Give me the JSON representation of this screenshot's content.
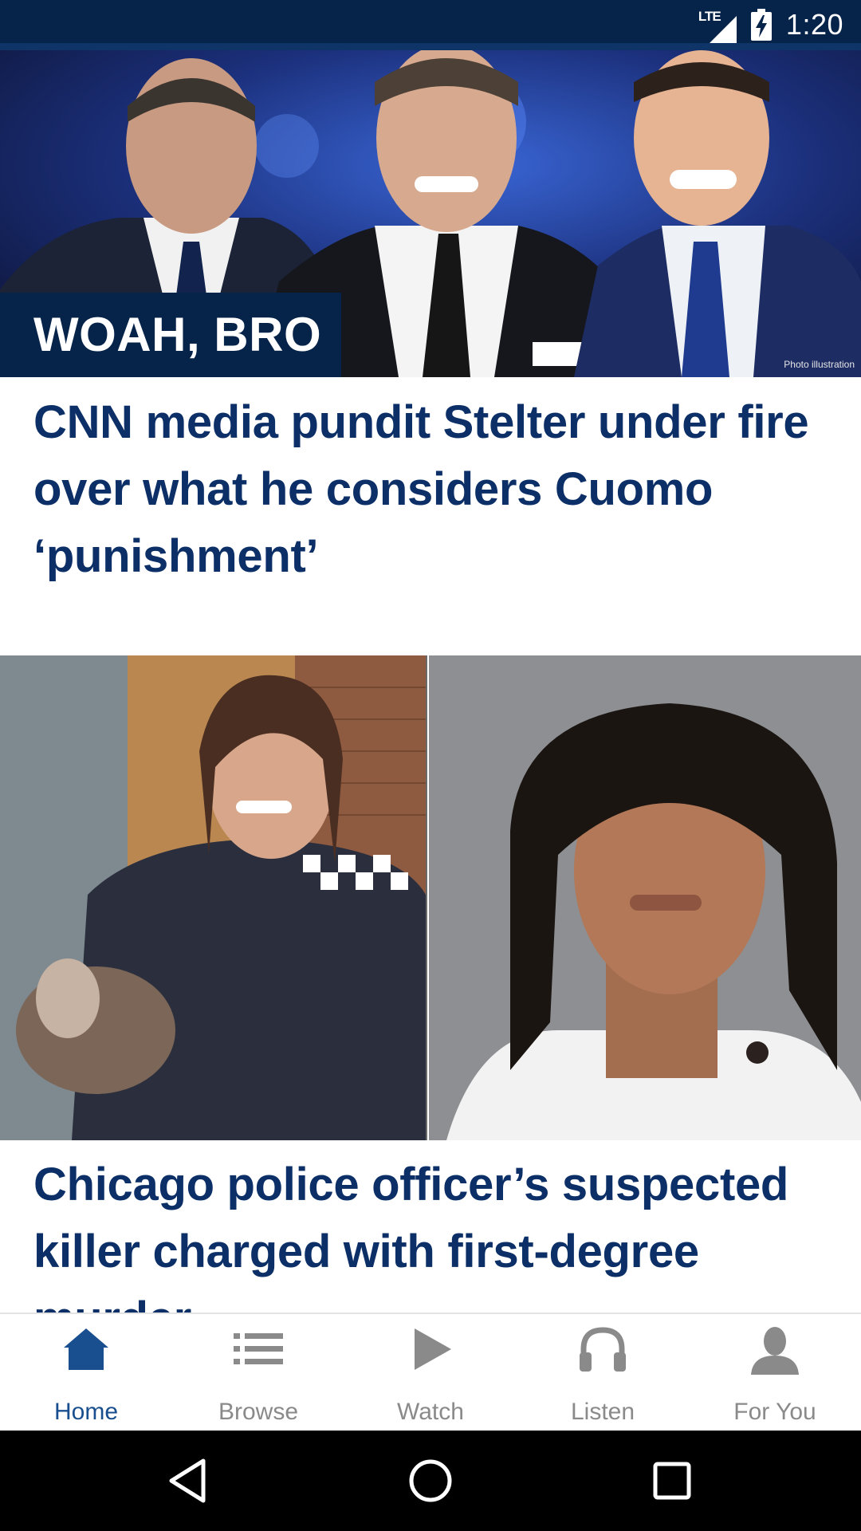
{
  "status_bar": {
    "network": "LTE",
    "time": "1:20",
    "icons": [
      "signal-icon",
      "battery-charging-icon"
    ]
  },
  "stories": [
    {
      "banner": "WOAH, BRO",
      "photo_credit": "Photo illustration",
      "headline": "CNN media pundit Stelter under fire over what he considers Cuomo ‘punishment’"
    },
    {
      "headline": "Chicago police officer’s suspected killer charged with first-degree murder"
    }
  ],
  "bottom_nav": {
    "active": "Home",
    "items": [
      {
        "label": "Home",
        "icon": "home-icon"
      },
      {
        "label": "Browse",
        "icon": "list-icon"
      },
      {
        "label": "Watch",
        "icon": "play-icon"
      },
      {
        "label": "Listen",
        "icon": "headphones-icon"
      },
      {
        "label": "For You",
        "icon": "person-icon"
      }
    ]
  },
  "system_nav": {
    "icons": [
      "back-icon",
      "home-circle-icon",
      "recents-icon"
    ]
  },
  "colors": {
    "brand_navy": "#06234a",
    "headline_blue": "#0b2f66",
    "active_tab": "#1a4f8f",
    "inactive_tab": "#8a8a8a"
  }
}
